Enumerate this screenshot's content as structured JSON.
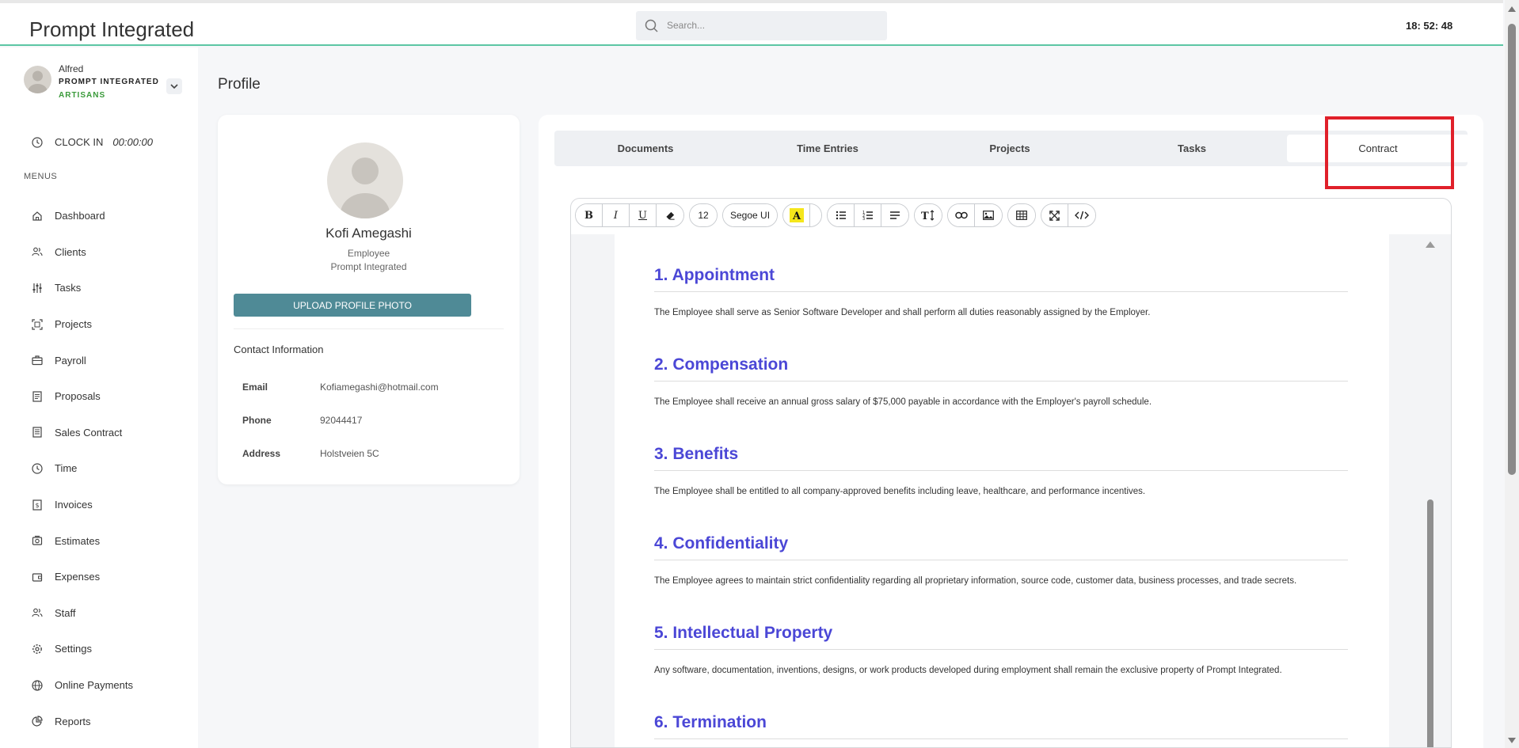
{
  "app": {
    "title": "Prompt Integrated",
    "clock": "18: 52: 48"
  },
  "search": {
    "placeholder": "Search..."
  },
  "user": {
    "name": "Alfred",
    "company": "PROMPT INTEGRATED",
    "role": "ARTISANS"
  },
  "clockin": {
    "label": "CLOCK IN",
    "time": "00:00:00"
  },
  "menus_heading": "MENUS",
  "nav": [
    {
      "label": "Dashboard",
      "icon": "home-icon"
    },
    {
      "label": "Clients",
      "icon": "users-icon"
    },
    {
      "label": "Tasks",
      "icon": "sliders-icon"
    },
    {
      "label": "Projects",
      "icon": "frame-icon"
    },
    {
      "label": "Payroll",
      "icon": "briefcase-icon"
    },
    {
      "label": "Proposals",
      "icon": "document-icon"
    },
    {
      "label": "Sales Contract",
      "icon": "contract-icon"
    },
    {
      "label": "Time",
      "icon": "clock-icon"
    },
    {
      "label": "Invoices",
      "icon": "invoice-icon"
    },
    {
      "label": "Estimates",
      "icon": "calculator-icon"
    },
    {
      "label": "Expenses",
      "icon": "wallet-icon"
    },
    {
      "label": "Staff",
      "icon": "staff-icon"
    },
    {
      "label": "Settings",
      "icon": "gear-icon"
    },
    {
      "label": "Online Payments",
      "icon": "globe-icon"
    },
    {
      "label": "Reports",
      "icon": "pie-chart-icon"
    }
  ],
  "page_title": "Profile",
  "profile": {
    "name": "Kofi Amegashi",
    "role": "Employee",
    "company": "Prompt Integrated",
    "upload_label": "UPLOAD PROFILE PHOTO",
    "contact_heading": "Contact Information",
    "contact": [
      {
        "key": "Email",
        "value": "Kofiamegashi@hotmail.com"
      },
      {
        "key": "Phone",
        "value": "92044417"
      },
      {
        "key": "Address",
        "value": "Holstveien 5C"
      }
    ]
  },
  "tabs": [
    {
      "label": "Documents",
      "active": false
    },
    {
      "label": "Time Entries",
      "active": false
    },
    {
      "label": "Projects",
      "active": false
    },
    {
      "label": "Tasks",
      "active": false
    },
    {
      "label": "Contract",
      "active": true
    }
  ],
  "toolbar": {
    "font_size": "12",
    "font_name": "Segoe UI"
  },
  "contract": [
    {
      "heading": "1. Appointment",
      "text": "The Employee shall serve as Senior Software Developer and shall perform all duties reasonably assigned by the Employer."
    },
    {
      "heading": "2. Compensation",
      "text": "The Employee shall receive an annual gross salary of $75,000 payable in accordance with the Employer's payroll schedule."
    },
    {
      "heading": "3. Benefits",
      "text": "The Employee shall be entitled to all company-approved benefits including leave, healthcare, and performance incentives."
    },
    {
      "heading": "4. Confidentiality",
      "text": "The Employee agrees to maintain strict confidentiality regarding all proprietary information, source code, customer data, business processes, and trade secrets."
    },
    {
      "heading": "5. Intellectual Property",
      "text": "Any software, documentation, inventions, designs, or work products developed during employment shall remain the exclusive property of Prompt Integrated."
    },
    {
      "heading": "6. Termination",
      "text": ""
    }
  ],
  "colors": {
    "accent": "#5cc6a4",
    "heading": "#4b47d6",
    "upload_button": "#4f8a96",
    "highlight": "#e0202a",
    "role": "#3a9a3a"
  }
}
